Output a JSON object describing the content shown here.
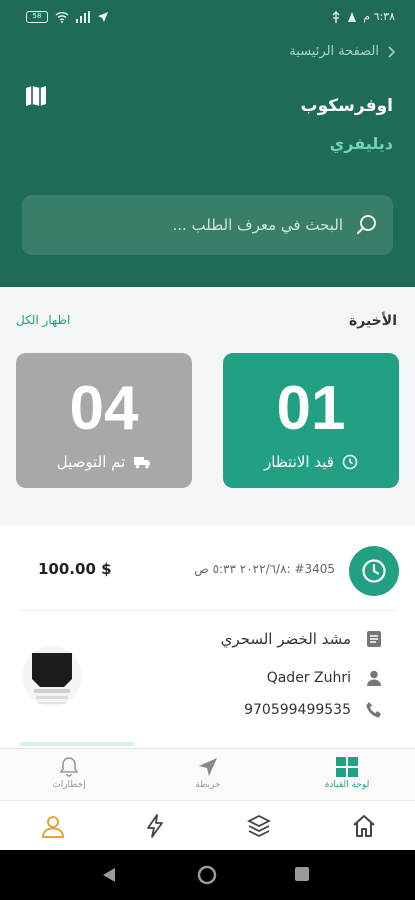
{
  "status_bar": {
    "time": "٦:٣٨ م",
    "battery": "58"
  },
  "header": {
    "breadcrumb": "الصفحة الرئيسية",
    "title": "اوفرسكوب",
    "subtitle": "ديليفري",
    "search_placeholder": "البحث في معرف الطلب ..."
  },
  "recent": {
    "title": "الأخيرة",
    "show_all": "اظهار الكل",
    "cards": [
      {
        "count": "01",
        "label": "قيد الانتظار",
        "icon": "clock-icon",
        "color": "#22a084"
      },
      {
        "count": "04",
        "label": "تم التوصيل",
        "icon": "truck-icon",
        "color": "#a8a8a8"
      }
    ]
  },
  "order": {
    "id_date": "#3405 :٢٠٢٢/٦/٨ ٥:٣٣ ص",
    "amount": "100.00 $",
    "customer": "مشد الخضر السحري",
    "driver": "Qader Zuhri",
    "phone": "970599499535"
  },
  "tabs": [
    {
      "label": "لوحة القيادة",
      "icon": "dashboard-icon",
      "active": true
    },
    {
      "label": "خريطة",
      "icon": "navigation-icon",
      "active": false
    },
    {
      "label": "إخطارات",
      "icon": "bell-icon",
      "active": false
    }
  ],
  "bottom_bar": [
    "home-icon",
    "layers-icon",
    "flash-icon",
    "user-icon"
  ],
  "accent_color": "#22a084",
  "header_color": "#1e6b57"
}
